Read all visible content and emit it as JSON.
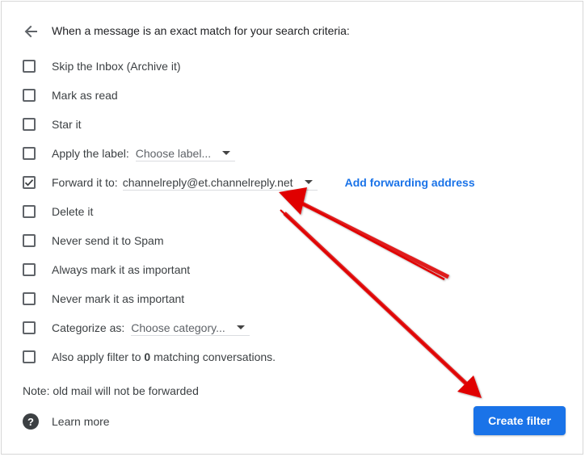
{
  "header": {
    "back_icon": "arrow-left-icon",
    "title": "When a message is an exact match for your search criteria:"
  },
  "options": {
    "skip_inbox": {
      "label": "Skip the Inbox (Archive it)",
      "checked": false
    },
    "mark_read": {
      "label": "Mark as read",
      "checked": false
    },
    "star": {
      "label": "Star it",
      "checked": false
    },
    "apply_label": {
      "label": "Apply the label:",
      "checked": false,
      "select_value": "Choose label..."
    },
    "forward": {
      "label": "Forward it to:",
      "checked": true,
      "select_value": "channelreply@et.channelreply.net",
      "link": "Add forwarding address"
    },
    "delete": {
      "label": "Delete it",
      "checked": false
    },
    "never_spam": {
      "label": "Never send it to Spam",
      "checked": false
    },
    "always_important": {
      "label": "Always mark it as important",
      "checked": false
    },
    "never_important": {
      "label": "Never mark it as important",
      "checked": false
    },
    "categorize": {
      "label": "Categorize as:",
      "checked": false,
      "select_value": "Choose category..."
    },
    "also_apply": {
      "prefix": "Also apply filter to ",
      "count": "0",
      "suffix": " matching conversations.",
      "checked": false
    }
  },
  "note": "Note: old mail will not be forwarded",
  "footer": {
    "help_icon": "help-circle-icon",
    "learn_more": "Learn more",
    "create_button": "Create filter"
  },
  "colors": {
    "accent": "#1a73e8",
    "annotation_arrow": "#e00000"
  }
}
